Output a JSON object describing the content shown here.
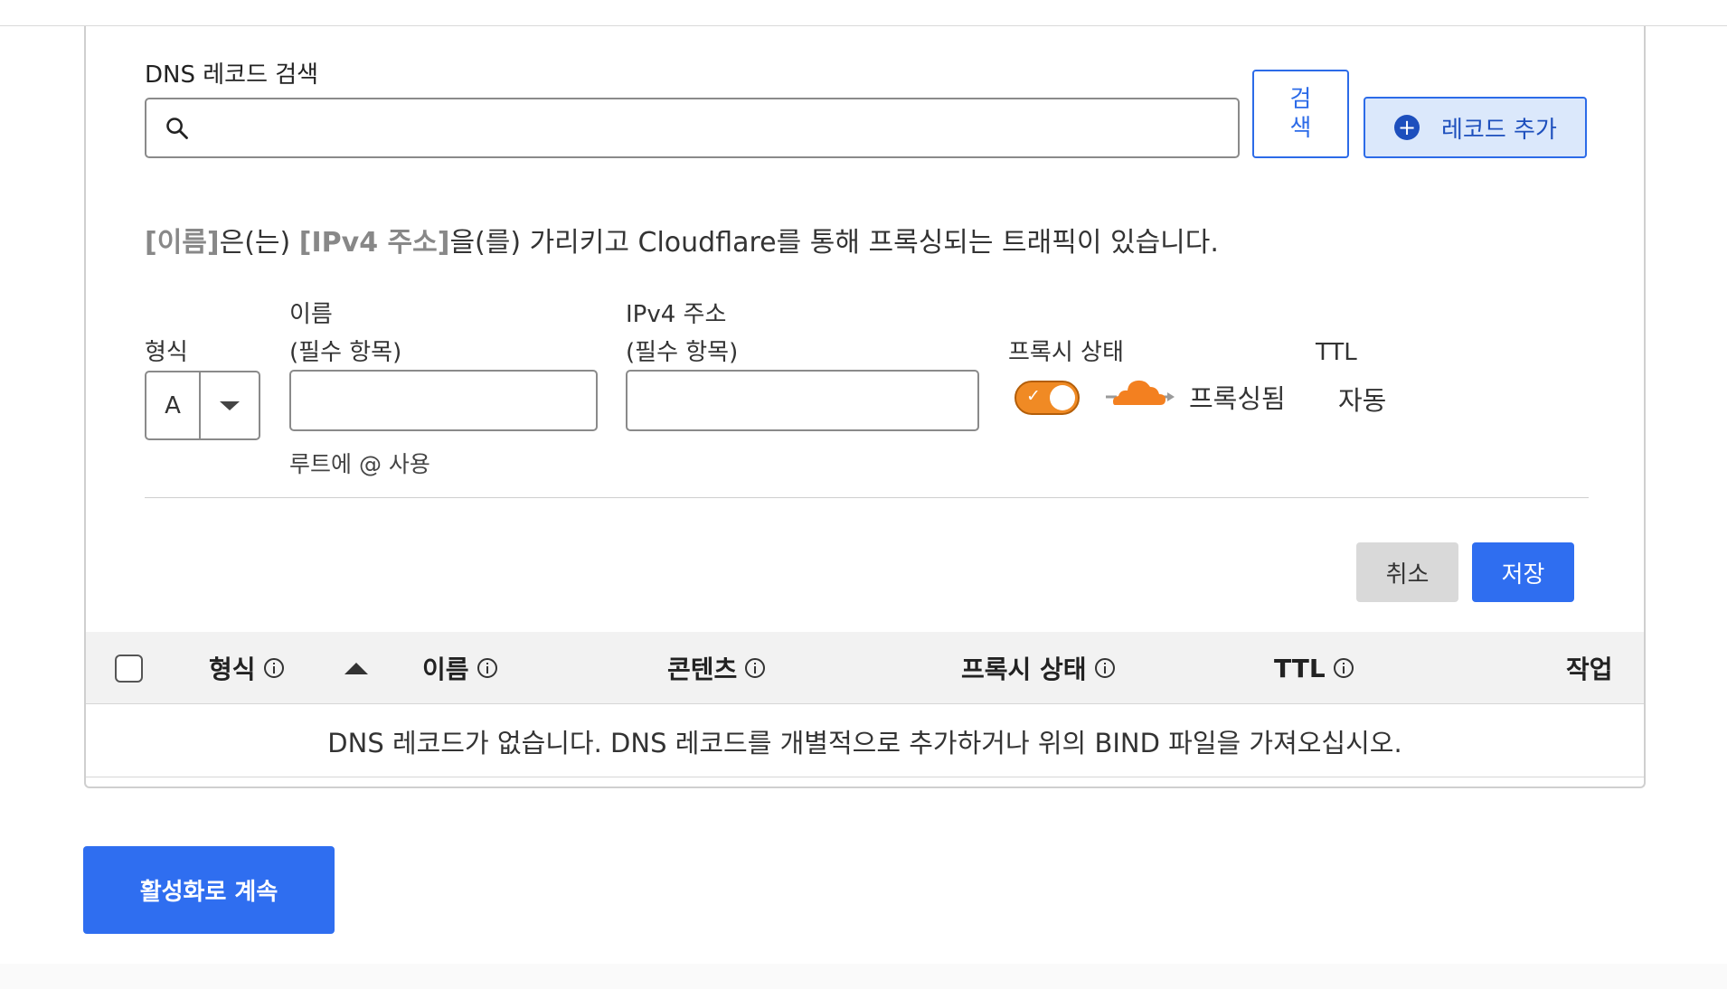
{
  "search": {
    "label": "DNS 레코드 검색",
    "value": "",
    "button_label": "검색"
  },
  "add_record_label": "레코드 추가",
  "description": {
    "name_placeholder": "[이름]",
    "part1": "은(는) ",
    "ipv4_placeholder": "[IPv4 주소]",
    "part2": "을(를) 가리키고 Cloudflare를 통해 프록싱되는 트래픽이 있습니다."
  },
  "form": {
    "type_label": "형식",
    "type_value": "A",
    "name_label_line1": "이름",
    "name_label_line2": "(필수 항목)",
    "name_value": "",
    "name_hint": "루트에 @ 사용",
    "ipv4_label_line1": "IPv4 주소",
    "ipv4_label_line2": "(필수 항목)",
    "ipv4_value": "",
    "proxy_label": "프록시 상태",
    "proxy_enabled": true,
    "proxy_status_text": "프록싱됨",
    "ttl_label": "TTL",
    "ttl_value": "자동",
    "cancel_label": "취소",
    "save_label": "저장"
  },
  "table": {
    "columns": [
      "형식",
      "이름",
      "콘텐츠",
      "프록시 상태",
      "TTL",
      "작업"
    ],
    "empty_message": "DNS 레코드가 없습니다. DNS 레코드를 개별적으로 추가하거나 위의 BIND 파일을 가져오십시오."
  },
  "continue_label": "활성화로 계속",
  "colors": {
    "primary": "#2f6ef0",
    "proxy_orange": "#f08a24",
    "add_button_bg": "#dbe8fb"
  }
}
